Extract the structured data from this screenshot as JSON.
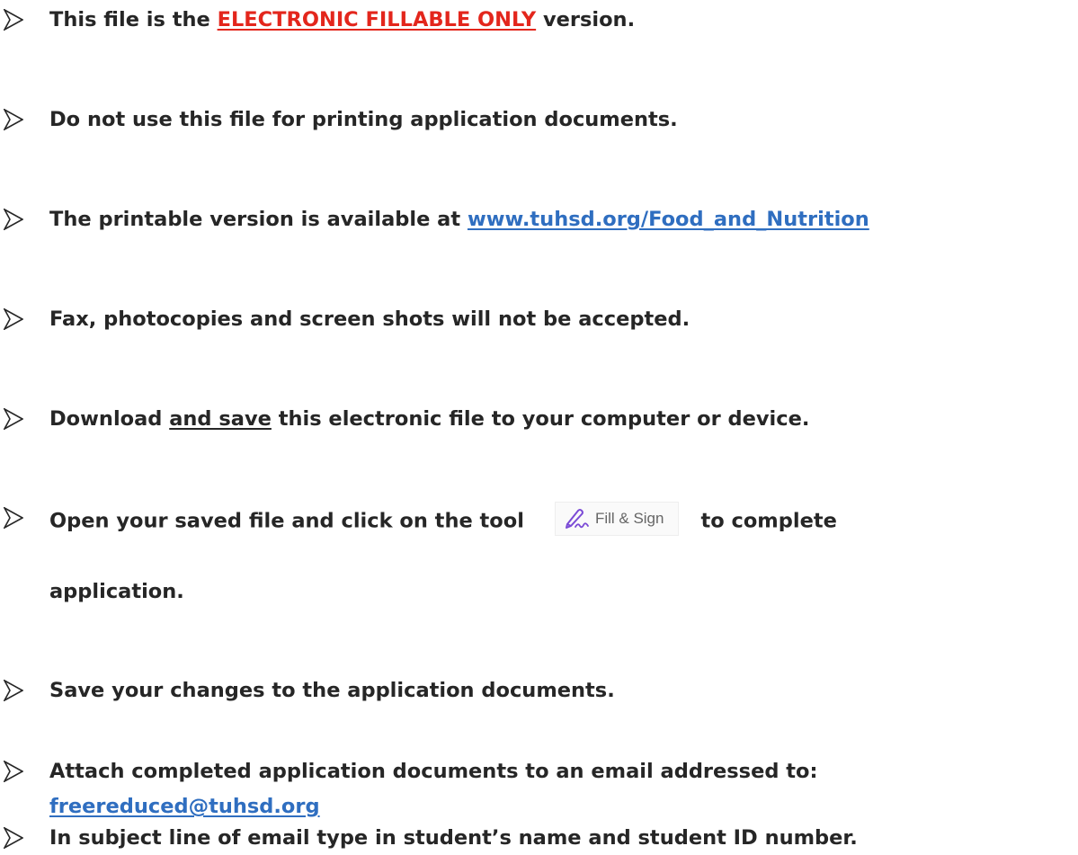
{
  "items": [
    {
      "before": "This file is the ",
      "link": "ELECTRONIC FILLABLE ONLY",
      "after": " version."
    },
    {
      "text": "Do not use this file for printing application documents."
    },
    {
      "before": "The printable version is available at ",
      "link": "www.tuhsd.org/Food_and_Nutrition"
    },
    {
      "text": "Fax, photocopies and screen shots will not be accepted."
    },
    {
      "before": "Download ",
      "underlined": "and save",
      "after": " this electronic file to your computer or device."
    },
    {
      "before": "Open your saved file and click on the tool",
      "button_label": "Fill & Sign",
      "after": "to complete",
      "continuation": "application."
    },
    {
      "text": "Save your changes to the application documents."
    },
    {
      "text": "Attach completed application documents to an email addressed to:",
      "email": "freereduced@tuhsd.org"
    },
    {
      "text": "In subject line of email type in student’s name and student ID number."
    }
  ],
  "colors": {
    "text": "#262626",
    "red_link": "#e3261c",
    "blue_link": "#2f6ec0",
    "fill_sign_icon": "#7b4bd6"
  },
  "icons": {
    "bullet": "arrow-bullet-icon",
    "fill_sign": "fill-sign-pen-icon"
  }
}
